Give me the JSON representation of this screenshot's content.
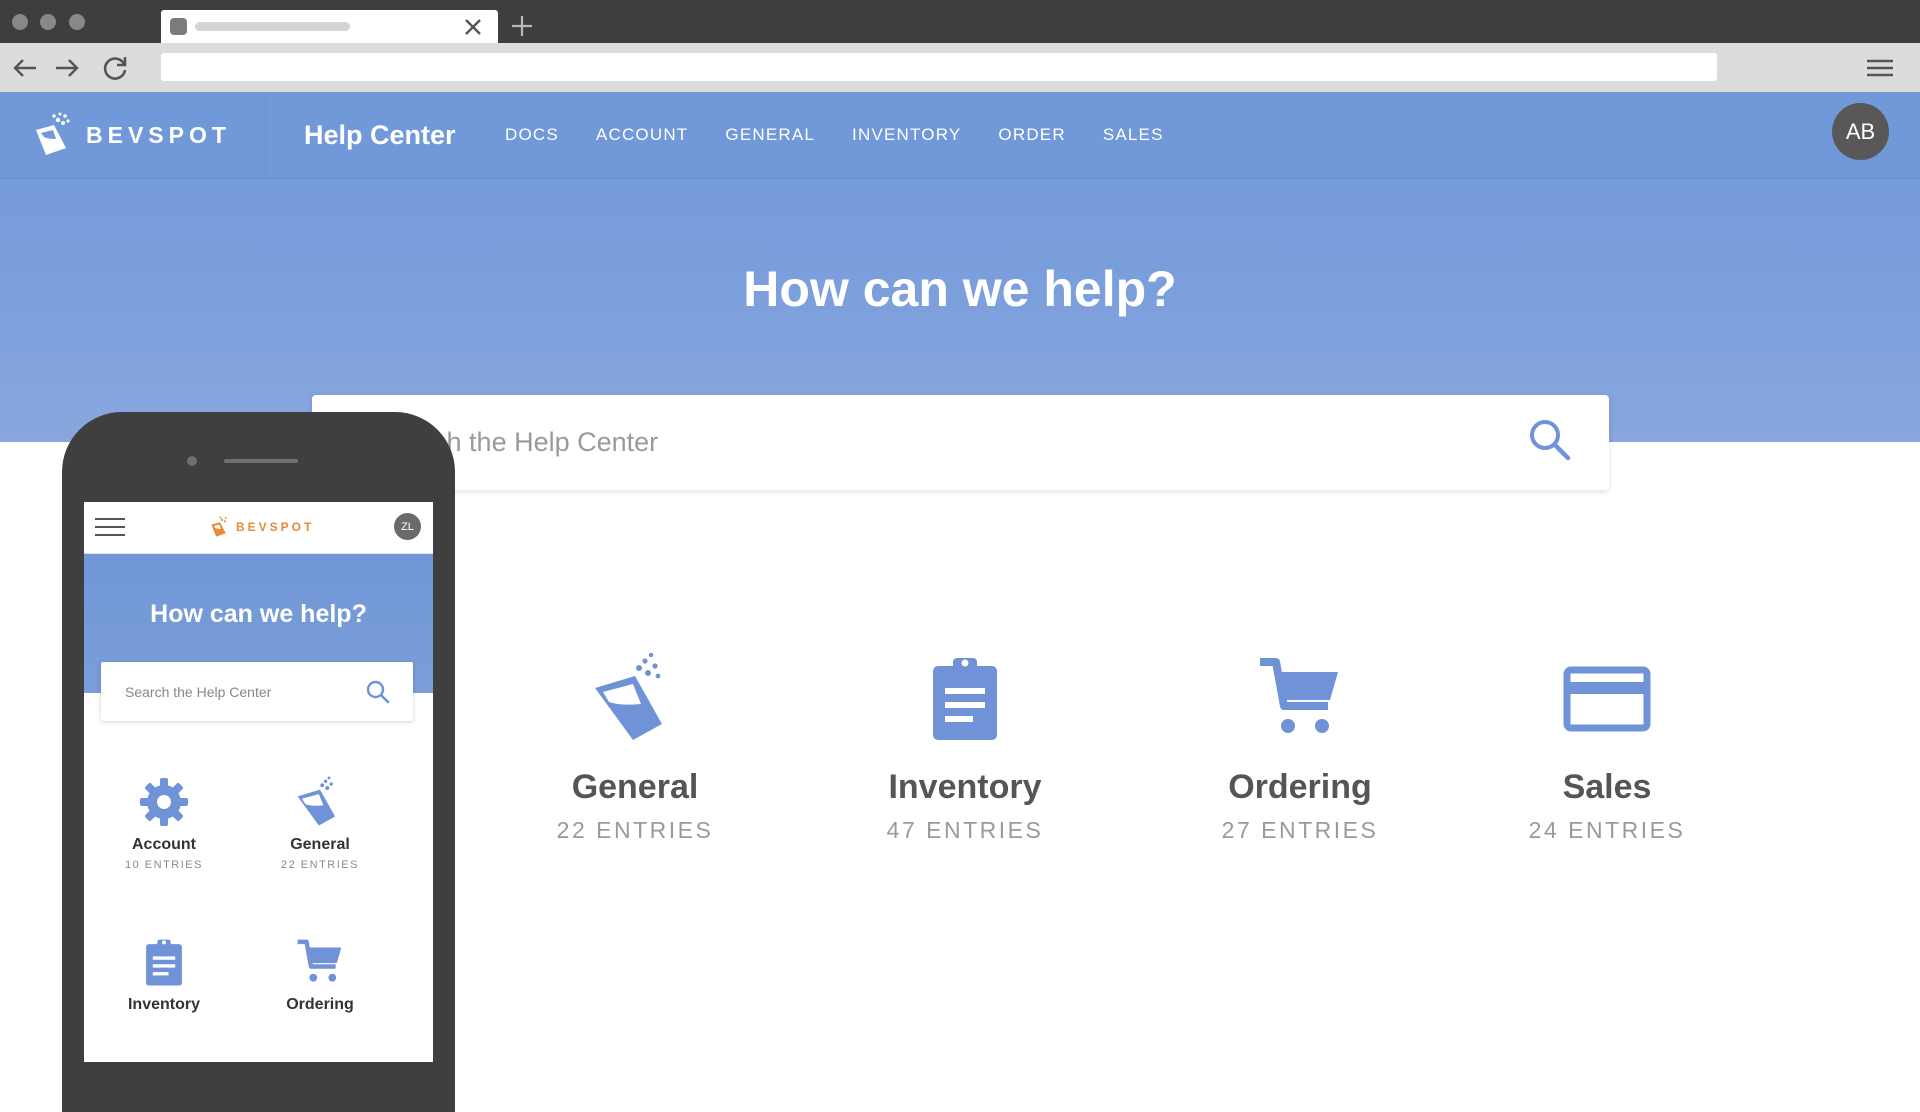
{
  "browser": {
    "tab": {
      "favicon_icon": "favicon-placeholder-icon",
      "close_icon": "close-icon"
    },
    "new_tab_icon": "plus-icon",
    "nav": {
      "back_icon": "arrow-left-icon",
      "forward_icon": "arrow-right-icon",
      "reload_icon": "reload-icon",
      "menu_icon": "hamburger-menu-icon"
    },
    "address_value": ""
  },
  "header": {
    "logo_text": "BEVSPOT",
    "title": "Help Center",
    "nav": [
      "DOCS",
      "ACCOUNT",
      "GENERAL",
      "INVENTORY",
      "ORDER",
      "SALES"
    ],
    "user_initials": "AB"
  },
  "hero": {
    "title": "How can we help?"
  },
  "search": {
    "placeholder": "Search the Help Center",
    "icon": "search-icon"
  },
  "categories": [
    {
      "label": "General",
      "count": "22 ENTRIES",
      "icon": "bucket-icon"
    },
    {
      "label": "Inventory",
      "count": "47 ENTRIES",
      "icon": "clipboard-icon"
    },
    {
      "label": "Ordering",
      "count": "27 ENTRIES",
      "icon": "cart-icon"
    },
    {
      "label": "Sales",
      "count": "24 ENTRIES",
      "icon": "credit-card-icon"
    }
  ],
  "mobile": {
    "logo_text": "BEVSPOT",
    "user_initials": "ZL",
    "hero_title": "How can we help?",
    "search_placeholder": "Search the Help Center",
    "categories": [
      {
        "label": "Account",
        "count": "10 ENTRIES",
        "icon": "gear-icon"
      },
      {
        "label": "General",
        "count": "22 ENTRIES",
        "icon": "bucket-icon"
      },
      {
        "label": "Inventory",
        "count": "",
        "icon": "clipboard-icon"
      },
      {
        "label": "Ordering",
        "count": "",
        "icon": "cart-icon"
      }
    ]
  },
  "colors": {
    "brand_blue": "#7198d9",
    "icon_blue": "#6f93d6",
    "mobile_logo_orange": "#e88a36",
    "text_dark": "#555555",
    "text_muted": "#9a9a9a"
  }
}
